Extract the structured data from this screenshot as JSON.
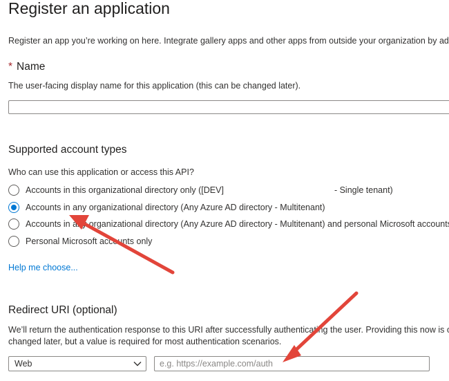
{
  "page": {
    "title": "Register an application",
    "intro": "Register an app you’re working on here. Integrate gallery apps and other apps from outside your organization by addi"
  },
  "name_section": {
    "required_marker": "*",
    "label": "Name",
    "description": "The user-facing display name for this application (this can be changed later).",
    "value": ""
  },
  "account_types": {
    "heading": "Supported account types",
    "question": "Who can use this application or access this API?",
    "options": [
      {
        "label_start": "Accounts in this organizational directory only ([DEV]",
        "label_end": "- Single tenant)",
        "checked": false
      },
      {
        "label": "Accounts in any organizational directory (Any Azure AD directory - Multitenant)",
        "checked": true
      },
      {
        "label": "Accounts in any organizational directory (Any Azure AD directory - Multitenant) and personal Microsoft accounts (",
        "checked": false
      },
      {
        "label": "Personal Microsoft accounts only",
        "checked": false
      }
    ],
    "help_link": "Help me choose..."
  },
  "redirect": {
    "heading": "Redirect URI (optional)",
    "description_line1": "We’ll return the authentication response to this URI after successfully authenticating the user. Providing this now is opti",
    "description_line2": "changed later, but a value is required for most authentication scenarios.",
    "platform_value": "Web",
    "uri_placeholder": "e.g. https://example.com/auth",
    "uri_value": ""
  },
  "annotation_color": "#e2453a"
}
